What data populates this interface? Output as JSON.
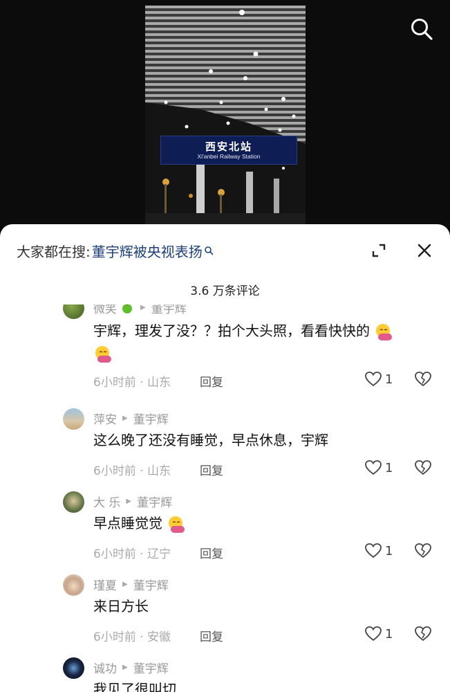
{
  "video": {
    "sign_cn": "西安北站",
    "sign_en": "Xi'anbei Railway Station",
    "search_icon": "search-icon"
  },
  "sheet": {
    "search_prefix": "大家都在搜:",
    "search_term": "董宇辉被央视表扬",
    "comment_count": "3.6 万条评论"
  },
  "comments": [
    {
      "author": "微笑",
      "reply_to": "董宇辉",
      "text": "宇辉，理发了没？？拍个大头照，看看快快的",
      "time_location": "6小时前 · 山东",
      "reply_label": "回复",
      "likes": "1"
    },
    {
      "author": "萍安",
      "reply_to": "董宇辉",
      "text": "这么晚了还没有睡觉，早点休息，宇辉",
      "time_location": "6小时前 · 山东",
      "reply_label": "回复",
      "likes": "1"
    },
    {
      "author": "大 乐",
      "reply_to": "董宇辉",
      "text": "早点睡觉觉",
      "time_location": "6小时前 · 辽宁",
      "reply_label": "回复",
      "likes": "1"
    },
    {
      "author": "瑾夏",
      "reply_to": "董宇辉",
      "text": "来日方长",
      "time_location": "6小时前 · 安徽",
      "reply_label": "回复",
      "likes": "1"
    },
    {
      "author": "诚功",
      "reply_to": "董宇辉",
      "text": "我见了很叫切"
    }
  ],
  "colors": {
    "search_term": "#1e3f7a",
    "sign_background": "#0f1d55",
    "sheet_background": "#ffffff"
  }
}
